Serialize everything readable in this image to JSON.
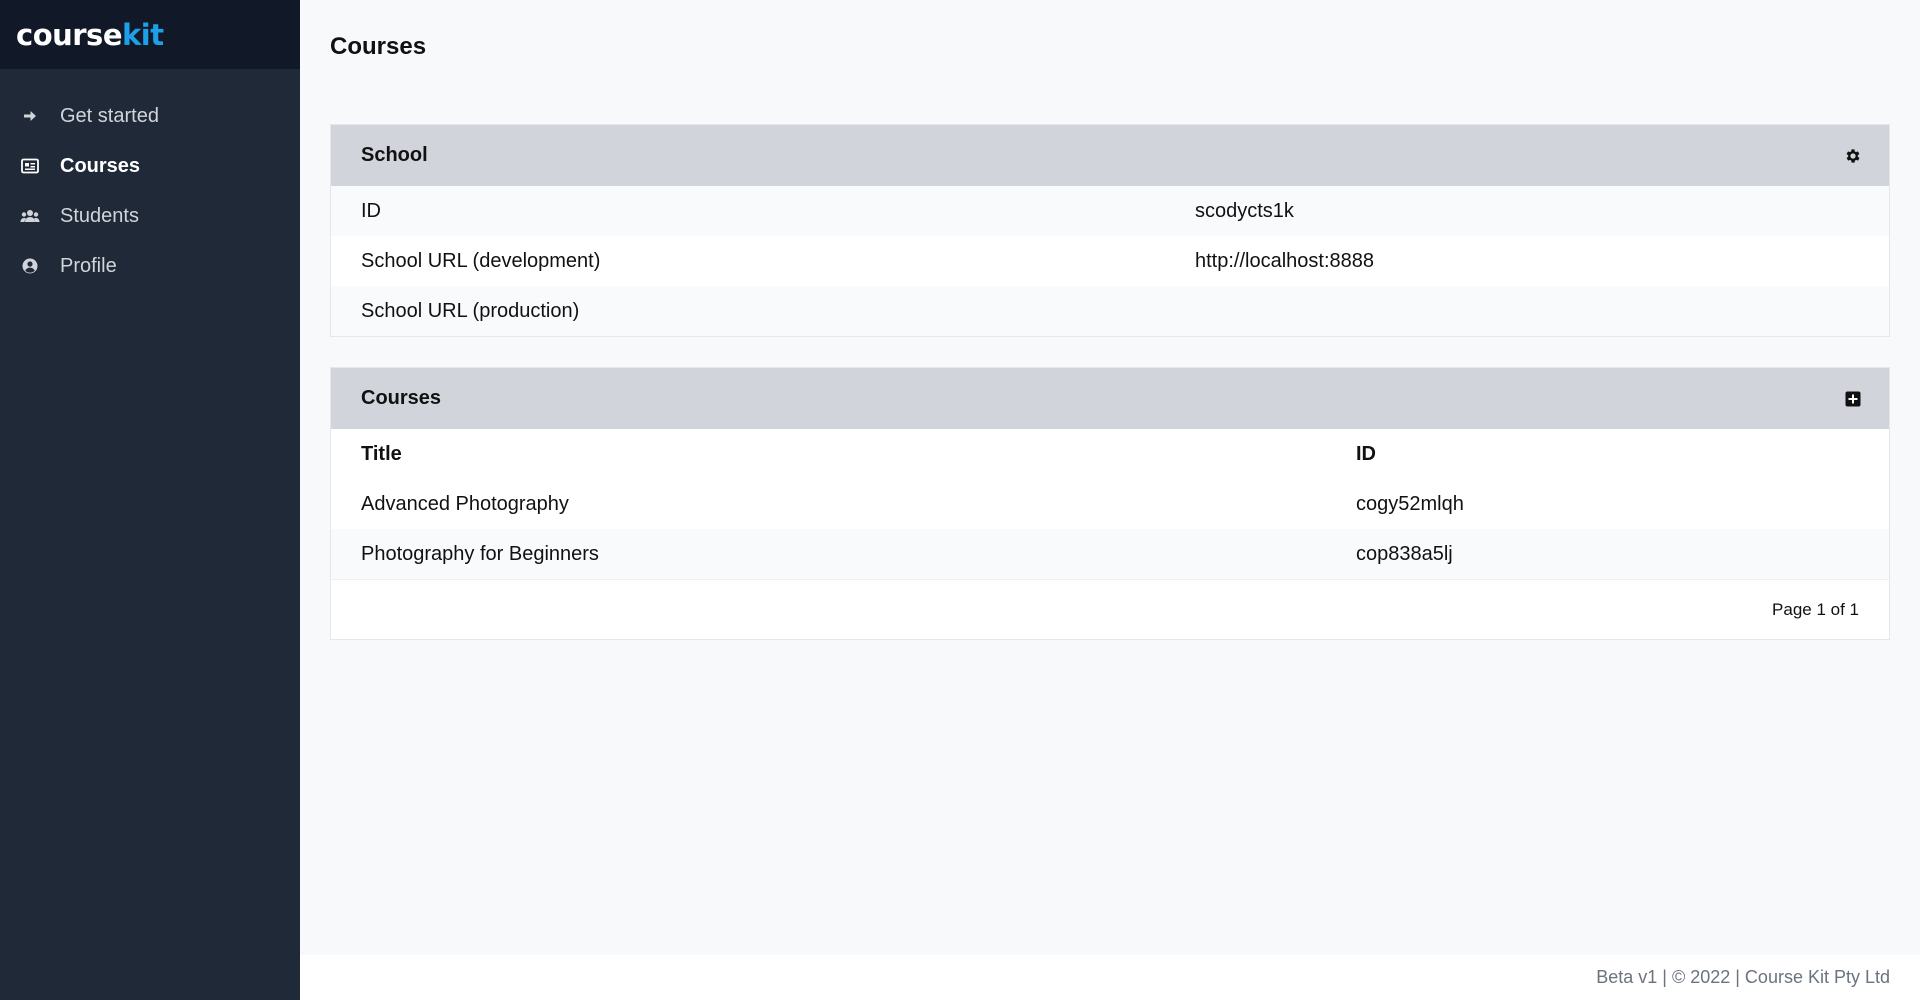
{
  "brand": {
    "part1": "course",
    "part2": "kit",
    "accent_color": "#1ea0e8"
  },
  "sidebar": {
    "items": [
      {
        "label": "Get started",
        "icon": "arrow-right-icon",
        "active": false
      },
      {
        "label": "Courses",
        "icon": "newspaper-icon",
        "active": true
      },
      {
        "label": "Students",
        "icon": "users-icon",
        "active": false
      },
      {
        "label": "Profile",
        "icon": "user-circle-icon",
        "active": false
      }
    ]
  },
  "main": {
    "title": "Courses",
    "school": {
      "header": "School",
      "action_icon": "gear-icon",
      "rows": [
        {
          "label": "ID",
          "value": "scodycts1k"
        },
        {
          "label": "School URL (development)",
          "value": "http://localhost:8888"
        },
        {
          "label": "School URL (production)",
          "value": ""
        }
      ]
    },
    "courses": {
      "header": "Courses",
      "action_icon": "plus-square-icon",
      "columns": [
        "Title",
        "ID"
      ],
      "rows": [
        {
          "title": "Advanced Photography",
          "id": "cogy52mlqh"
        },
        {
          "title": "Photography for Beginners",
          "id": "cop838a5lj"
        }
      ],
      "pagination": "Page 1 of 1"
    }
  },
  "footer": {
    "text": "Beta v1 | © 2022 | Course Kit Pty Ltd"
  }
}
